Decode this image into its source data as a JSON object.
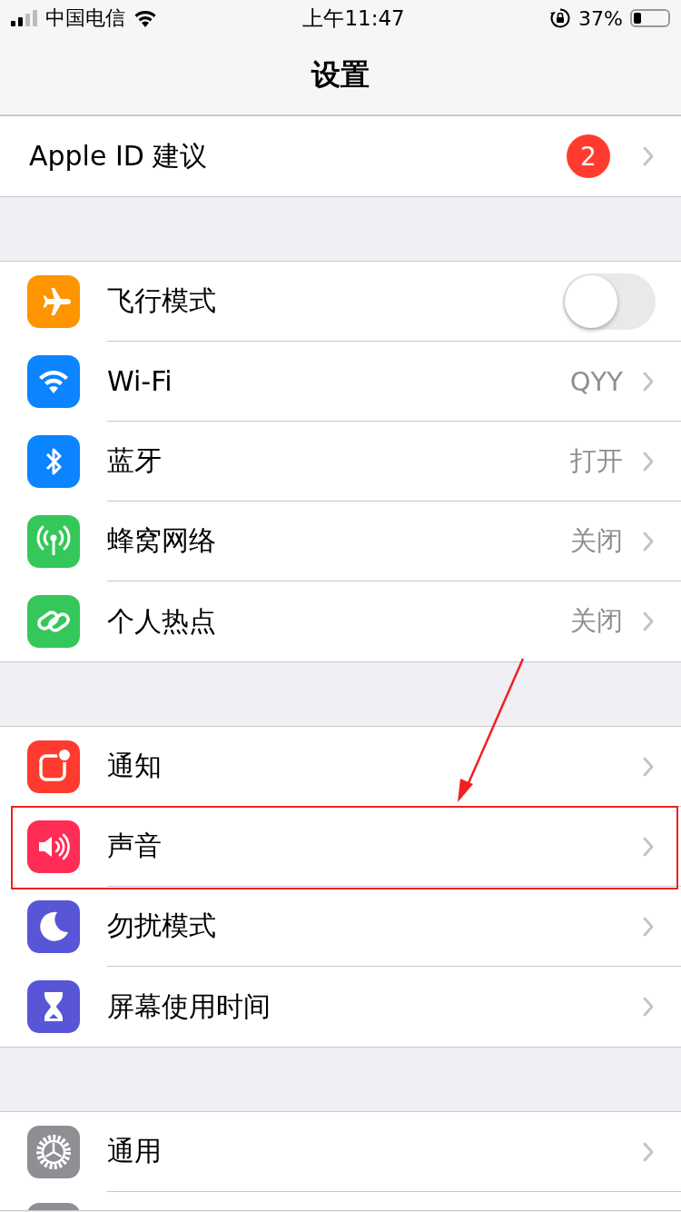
{
  "status_bar": {
    "carrier": "中国电信",
    "time": "上午11:47",
    "battery_percent": "37%"
  },
  "nav": {
    "title": "设置"
  },
  "groups": [
    {
      "rows": [
        {
          "kind": "account",
          "label": "Apple ID 建议",
          "badge": "2"
        }
      ]
    },
    {
      "rows": [
        {
          "kind": "toggle",
          "color": "#fe9500",
          "label": "飞行模式",
          "on": false
        },
        {
          "kind": "link",
          "color": "#0a84ff",
          "label": "Wi-Fi",
          "value": "QYY"
        },
        {
          "kind": "link",
          "color": "#0a84ff",
          "label": "蓝牙",
          "value": "打开"
        },
        {
          "kind": "link",
          "color": "#34c759",
          "label": "蜂窝网络",
          "value": "关闭"
        },
        {
          "kind": "link",
          "color": "#34c759",
          "label": "个人热点",
          "value": "关闭"
        }
      ]
    },
    {
      "rows": [
        {
          "kind": "link",
          "color": "#ff3b30",
          "label": "通知"
        },
        {
          "kind": "link",
          "color": "#ff2d55",
          "label": "声音",
          "annotated": true
        },
        {
          "kind": "link",
          "color": "#5856d6",
          "label": "勿扰模式"
        },
        {
          "kind": "link",
          "color": "#5856d6",
          "label": "屏幕使用时间"
        }
      ]
    },
    {
      "rows": [
        {
          "kind": "link",
          "color": "#8e8e93",
          "label": "通用"
        },
        {
          "kind": "partial",
          "color": "#8e8e93"
        }
      ]
    }
  ]
}
